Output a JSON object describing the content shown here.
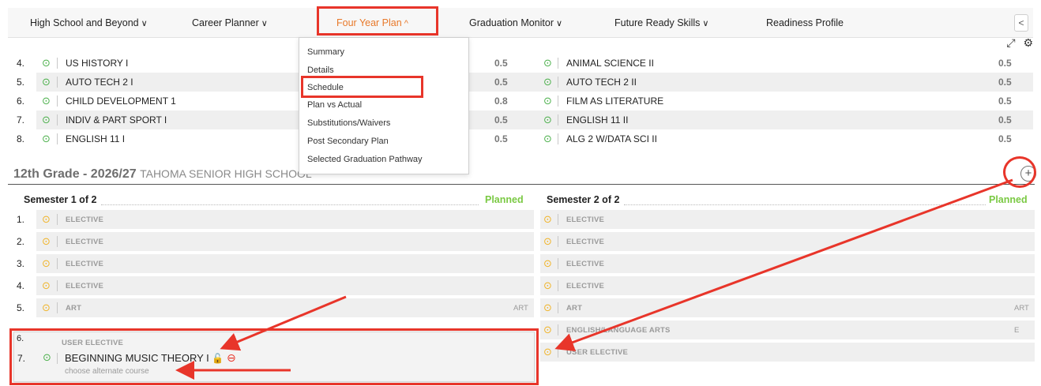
{
  "nav": {
    "items": [
      {
        "label": "High School and Beyond",
        "chev": "∨"
      },
      {
        "label": "Career Planner",
        "chev": "∨"
      },
      {
        "label": "Four Year Plan",
        "chev": "^"
      },
      {
        "label": "Graduation Monitor",
        "chev": "∨"
      },
      {
        "label": "Future Ready Skills",
        "chev": "∨"
      },
      {
        "label": "Readiness Profile",
        "chev": ""
      }
    ],
    "collapse_icon": "<",
    "accent": "#e8792a"
  },
  "dropdown": {
    "items": [
      "Summary",
      "Details",
      "Schedule",
      "Plan vs Actual",
      "Substitutions/Waivers",
      "Post Secondary Plan",
      "Selected Graduation Pathway"
    ]
  },
  "toolbar": {
    "expand_icon": "⤢",
    "settings_icon": "⚙"
  },
  "prior_rows": [
    {
      "num": "4.",
      "left_course": "US HISTORY I",
      "left_credit": "0.5",
      "right_course": "ANIMAL SCIENCE II",
      "right_credit": "0.5"
    },
    {
      "num": "5.",
      "left_course": "AUTO TECH 2 I",
      "left_credit": "0.5",
      "right_course": "AUTO TECH 2 II",
      "right_credit": "0.5"
    },
    {
      "num": "6.",
      "left_course": "CHILD DEVELOPMENT 1",
      "left_credit": "0.8",
      "right_course": "FILM AS LITERATURE",
      "right_credit": "0.5"
    },
    {
      "num": "7.",
      "left_course": "INDIV & PART SPORT I",
      "left_credit": "0.5",
      "right_course": "ENGLISH 11 II",
      "right_credit": "0.5"
    },
    {
      "num": "8.",
      "left_course": "ENGLISH 11 I",
      "left_credit": "0.5",
      "right_course": "ALG 2 W/DATA SCI II",
      "right_credit": "0.5"
    }
  ],
  "grade": {
    "title": "12th Grade - 2026/27",
    "school": "TAHOMA SENIOR HIGH SCHOOL",
    "add_icon": "+"
  },
  "semesters": {
    "left": {
      "title": "Semester 1 of 2",
      "status": "Planned"
    },
    "right": {
      "title": "Semester 2 of 2",
      "status": "Planned"
    }
  },
  "grade12_rows": [
    {
      "num": "1.",
      "left": "ELECTIVE",
      "left_tag": "",
      "right": "ELECTIVE",
      "right_tag": ""
    },
    {
      "num": "2.",
      "left": "ELECTIVE",
      "left_tag": "",
      "right": "ELECTIVE",
      "right_tag": ""
    },
    {
      "num": "3.",
      "left": "ELECTIVE",
      "left_tag": "",
      "right": "ELECTIVE",
      "right_tag": ""
    },
    {
      "num": "4.",
      "left": "ELECTIVE",
      "left_tag": "",
      "right": "ELECTIVE",
      "right_tag": ""
    },
    {
      "num": "5.",
      "left": "ART",
      "left_tag": "ART",
      "right": "ART",
      "right_tag": "ART"
    },
    {
      "num": "6.",
      "left": "",
      "left_tag": "",
      "right": "ENGLISH/LANGUAGE ARTS",
      "right_tag": "E"
    },
    {
      "num": "7.",
      "left": "",
      "left_tag": "",
      "right": "USER ELECTIVE",
      "right_tag": ""
    }
  ],
  "popup": {
    "category": "USER ELECTIVE",
    "course": "BEGINNING MUSIC THEORY I",
    "lock_icon": "🔓",
    "remove_icon": "⊖",
    "alt_link": "choose alternate course"
  },
  "colors": {
    "annotation_red": "#e8352a",
    "planned_green": "#7ac943",
    "check_green": "#4bb04b",
    "check_yellow": "#f0b429"
  }
}
